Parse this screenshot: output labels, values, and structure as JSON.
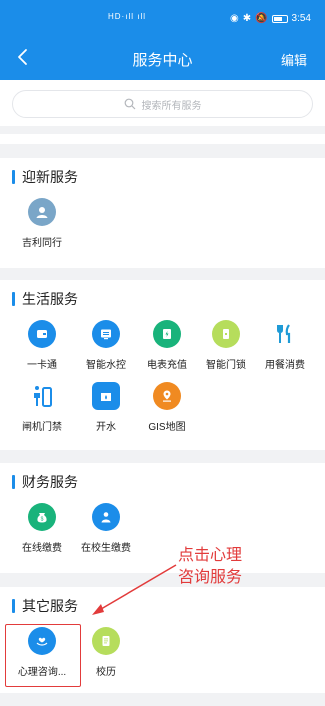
{
  "status_bar": {
    "signal": "HD·ıll ıll",
    "time": "3:54"
  },
  "header": {
    "title": "服务中心",
    "edit_label": "编辑"
  },
  "search": {
    "placeholder": "搜索所有服务"
  },
  "sections": [
    {
      "title": "迎新服务",
      "items": [
        {
          "label": "吉利同行",
          "icon": "user-circle",
          "color": "#7aa6c8"
        }
      ]
    },
    {
      "title": "生活服务",
      "items": [
        {
          "label": "一卡通",
          "icon": "card",
          "color": "#1b8de9"
        },
        {
          "label": "智能水控",
          "icon": "screen",
          "color": "#1b8de9"
        },
        {
          "label": "电表充值",
          "icon": "meter",
          "color": "#19b37b"
        },
        {
          "label": "智能门锁",
          "icon": "lock",
          "color": "#b6dd5c"
        },
        {
          "label": "用餐消费",
          "icon": "fork-knife",
          "color": "#1f9bd6"
        },
        {
          "label": "闸机门禁",
          "icon": "gate",
          "color": "#1b8de9"
        },
        {
          "label": "开水",
          "icon": "water",
          "color": "#1b8de9"
        },
        {
          "label": "GIS地图",
          "icon": "map-pin",
          "color": "#f08a21"
        }
      ]
    },
    {
      "title": "财务服务",
      "items": [
        {
          "label": "在线缴费",
          "icon": "money-bag",
          "color": "#19b37b"
        },
        {
          "label": "在校生缴费",
          "icon": "student",
          "color": "#1b8de9"
        }
      ]
    },
    {
      "title": "其它服务",
      "items": [
        {
          "label": "心理咨询...",
          "icon": "heart-hand",
          "color": "#1b8de9"
        },
        {
          "label": "校历",
          "icon": "calendar",
          "color": "#b6dd5c"
        }
      ]
    }
  ],
  "annotation": {
    "text_line1": "点击心理",
    "text_line2": "咨询服务",
    "color": "#e23b3b"
  }
}
